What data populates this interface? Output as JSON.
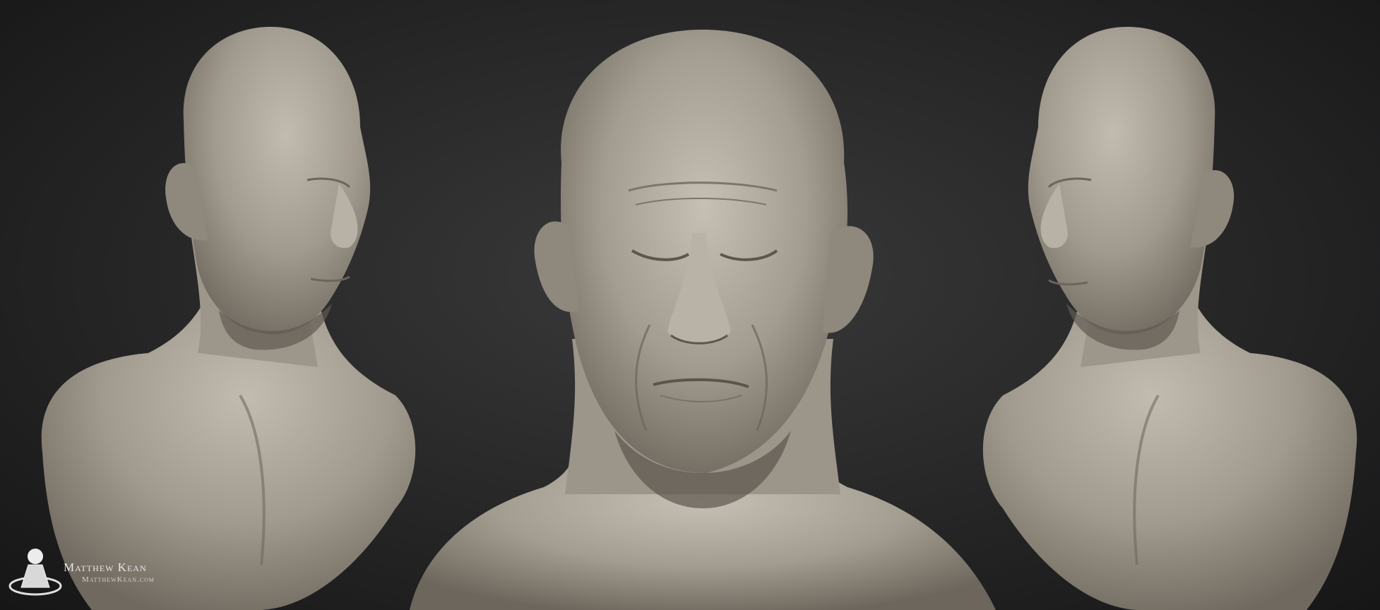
{
  "scene": {
    "background_color": "#2a2a2b",
    "sculpt_color": "#a9a296",
    "views": [
      {
        "name": "left three-quarter view"
      },
      {
        "name": "front view"
      },
      {
        "name": "right three-quarter view"
      }
    ]
  },
  "watermark": {
    "name": "Matthew Kean",
    "url": "MatthewKean.com",
    "icon": "pedestal-sphere-logo-icon"
  }
}
